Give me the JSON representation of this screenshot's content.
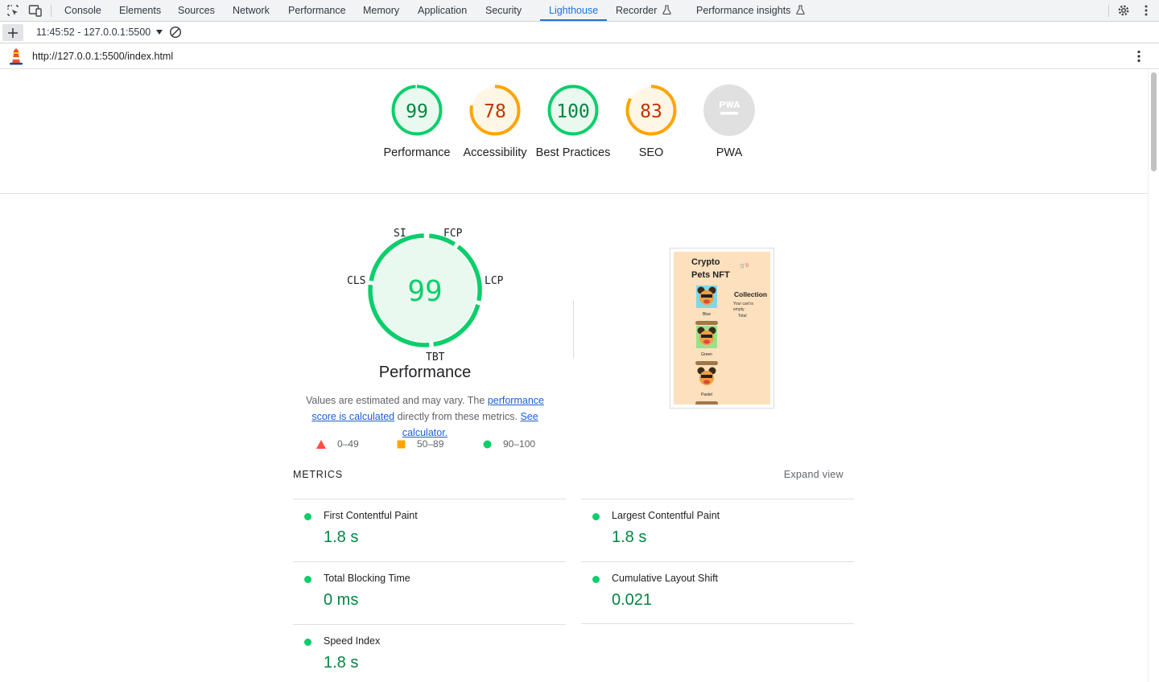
{
  "devtools": {
    "tabs": [
      "Console",
      "Elements",
      "Sources",
      "Network",
      "Performance",
      "Memory",
      "Application",
      "Security",
      "Lighthouse",
      "Recorder",
      "Performance insights"
    ],
    "active_tab": "Lighthouse"
  },
  "report_bar": {
    "report_selector": "11:45:52 - 127.0.0.1:5500"
  },
  "url_bar": {
    "url": "http://127.0.0.1:5500/index.html"
  },
  "gauges": [
    {
      "label": "Performance",
      "score": "99",
      "rating": "pass"
    },
    {
      "label": "Accessibility",
      "score": "78",
      "rating": "average"
    },
    {
      "label": "Best Practices",
      "score": "100",
      "rating": "pass"
    },
    {
      "label": "SEO",
      "score": "83",
      "rating": "average"
    },
    {
      "label": "PWA",
      "score": "",
      "rating": "na"
    }
  ],
  "performance": {
    "score": "99",
    "title": "Performance",
    "metric_labels": {
      "si": "SI",
      "fcp": "FCP",
      "lcp": "LCP",
      "tbt": "TBT",
      "cls": "CLS"
    },
    "description_before": "Values are estimated and may vary. The ",
    "description_link1": "performance score is calculated",
    "description_middle": " directly from these metrics. ",
    "description_link2": "See calculator.",
    "legend": {
      "fail": "0–49",
      "average": "50–89",
      "pass": "90–100"
    }
  },
  "screenshot_preview": {
    "title": "Crypto Pets NFT",
    "cart_count": "0",
    "heading": "Collection",
    "cart_text": "Your cart is empty",
    "total_label": "Total",
    "items": [
      "Blue",
      "Green",
      "Pastel"
    ]
  },
  "metrics_section": {
    "heading": "METRICS",
    "expand_label": "Expand view",
    "items": [
      {
        "name": "First Contentful Paint",
        "value": "1.8 s"
      },
      {
        "name": "Largest Contentful Paint",
        "value": "1.8 s"
      },
      {
        "name": "Total Blocking Time",
        "value": "0 ms"
      },
      {
        "name": "Cumulative Layout Shift",
        "value": "0.021"
      },
      {
        "name": "Speed Index",
        "value": "1.8 s"
      }
    ]
  },
  "colors": {
    "pass": "#0cce6b",
    "pass_text": "#018642",
    "average": "#ffa400",
    "average_text": "#c33300",
    "fail": "#ff4e42",
    "accent": "#1a73e8"
  }
}
